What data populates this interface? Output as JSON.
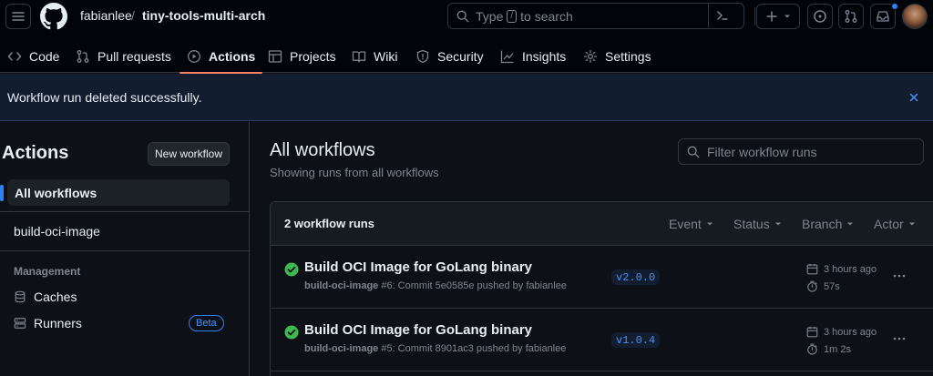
{
  "header": {
    "owner": "fabianlee",
    "separator": "/",
    "repo": "tiny-tools-multi-arch",
    "search_prefix": "Type",
    "search_key": "/",
    "search_suffix": "to search"
  },
  "tabs": [
    {
      "label": "Code",
      "icon": "code-icon"
    },
    {
      "label": "Pull requests",
      "icon": "pull-request-icon"
    },
    {
      "label": "Actions",
      "icon": "play-icon"
    },
    {
      "label": "Projects",
      "icon": "table-icon"
    },
    {
      "label": "Wiki",
      "icon": "book-icon"
    },
    {
      "label": "Security",
      "icon": "shield-icon"
    },
    {
      "label": "Insights",
      "icon": "graph-icon"
    },
    {
      "label": "Settings",
      "icon": "gear-icon"
    }
  ],
  "flash": {
    "message": "Workflow run deleted successfully."
  },
  "sidebar": {
    "title": "Actions",
    "new_workflow": "New workflow",
    "all_workflows": "All workflows",
    "workflow": "build-oci-image",
    "management_heading": "Management",
    "caches": "Caches",
    "runners": "Runners",
    "beta": "Beta"
  },
  "main": {
    "title": "All workflows",
    "subtitle": "Showing runs from all workflows",
    "filter_placeholder": "Filter workflow runs",
    "runs_count": "2 workflow runs",
    "filters": [
      "Event",
      "Status",
      "Branch",
      "Actor"
    ]
  },
  "runs": [
    {
      "title": "Build OCI Image for GoLang binary",
      "workflow": "build-oci-image",
      "detail": " #6: Commit 5e0585e pushed by fabianlee",
      "branch": "v2.0.0",
      "time": "3 hours ago",
      "duration": "57s",
      "status": "success"
    },
    {
      "title": "Build OCI Image for GoLang binary",
      "workflow": "build-oci-image",
      "detail": " #5: Commit 8901ac3 pushed by fabianlee",
      "branch": "v1.0.4",
      "time": "3 hours ago",
      "duration": "1m 2s",
      "status": "success"
    }
  ],
  "colors": {
    "background": "#0d1117",
    "accent": "#2f81f7",
    "success": "#3fb950",
    "tab_underline": "#f78166"
  }
}
